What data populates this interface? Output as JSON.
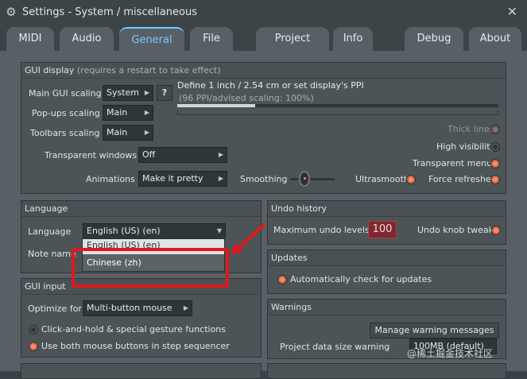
{
  "window": {
    "title": "Settings - System / miscellaneous"
  },
  "tabs": [
    "MIDI",
    "Audio",
    "General",
    "File",
    "Project",
    "Info",
    "Debug",
    "About"
  ],
  "gui_display": {
    "title": "GUI display",
    "subtitle": "(requires a restart to take effect)",
    "main_scaling_label": "Main GUI scaling",
    "main_scaling_value": "System",
    "help": "?",
    "ppi_text": "Define 1 inch / 2.54 cm or set display's PPI",
    "ppi_sub": "(96 PPI/advised scaling: 100%)",
    "popups_label": "Pop-ups scaling",
    "popups_value": "Main",
    "toolbars_label": "Toolbars scaling",
    "toolbars_value": "Main",
    "thick_lines": "Thick lines",
    "high_visibility": "High visibility",
    "transparent_menus": "Transparent menus",
    "transparent_windows_label": "Transparent windows",
    "transparent_windows_value": "Off",
    "animations_label": "Animations",
    "animations_value": "Make it pretty",
    "smoothing": "Smoothing",
    "ultrasmooth": "Ultrasmooth",
    "force_refreshes": "Force refreshes"
  },
  "language": {
    "title": "Language",
    "label": "Language",
    "value": "English (US) (en)",
    "note_label": "Note name",
    "options": [
      "English (US) (en)",
      "Chinese (zh)"
    ]
  },
  "undo": {
    "title": "Undo history",
    "max_label": "Maximum undo levels",
    "max_value": "100",
    "knob_tweaks": "Undo knob tweaks"
  },
  "updates": {
    "title": "Updates",
    "auto_check": "Automatically check for updates"
  },
  "gui_input": {
    "title": "GUI input",
    "optimize_label": "Optimize for",
    "optimize_value": "Multi-button mouse",
    "click_hold": "Click-and-hold & special gesture functions",
    "both_buttons": "Use both mouse buttons in step sequencer"
  },
  "warnings": {
    "title": "Warnings",
    "manage_btn": "Manage warning messages",
    "size_label": "Project data size warning",
    "size_value": "100MB (default)"
  },
  "watermark": "@稀土掘金技术社区"
}
